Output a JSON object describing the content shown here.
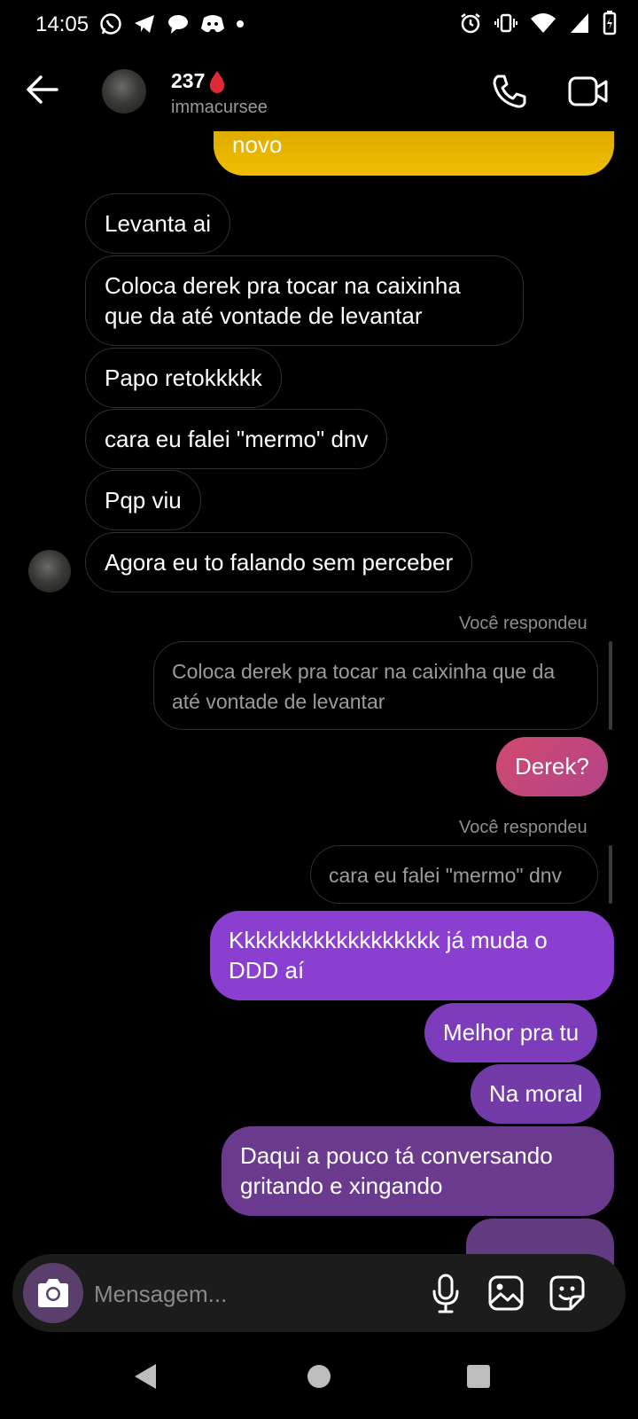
{
  "status_bar": {
    "time": "14:05"
  },
  "header": {
    "name": "237",
    "handle": "immacursee"
  },
  "messages": {
    "m0": "novo",
    "m1": "Levanta ai",
    "m2a": "Coloca derek pra tocar na caixinha",
    "m2b": "que da até vontade de levantar",
    "m3": "Papo retokkkkk",
    "m4": "cara eu falei \"mermo\" dnv",
    "m5": "Pqp viu",
    "m6": "Agora eu to falando sem perceber",
    "reply1_caption": "Você respondeu",
    "reply1_quote_a": "Coloca derek pra tocar na caixinha que da",
    "reply1_quote_b": "até vontade de levantar",
    "m7": "Derek?",
    "reply2_caption": "Você respondeu",
    "reply2_quote": "cara eu falei \"mermo\" dnv",
    "m8a": "Kkkkkkkkkkkkkkkkkk já muda o",
    "m8b": "DDD aí",
    "m9": "Melhor pra tu",
    "m10": "Na moral",
    "m11a": "Daqui a pouco tá conversando",
    "m11b": "gritando e xingando"
  },
  "composer": {
    "placeholder": "Mensagem..."
  },
  "colors": {
    "yellow": "#e9b800",
    "pink": "#c2457a",
    "purple": "#8a3fd0",
    "purple_dark": "#6a3a8f"
  },
  "icons": [
    "back-arrow-icon",
    "phone-icon",
    "video-icon",
    "camera-icon",
    "microphone-icon",
    "gallery-icon",
    "sticker-icon"
  ]
}
